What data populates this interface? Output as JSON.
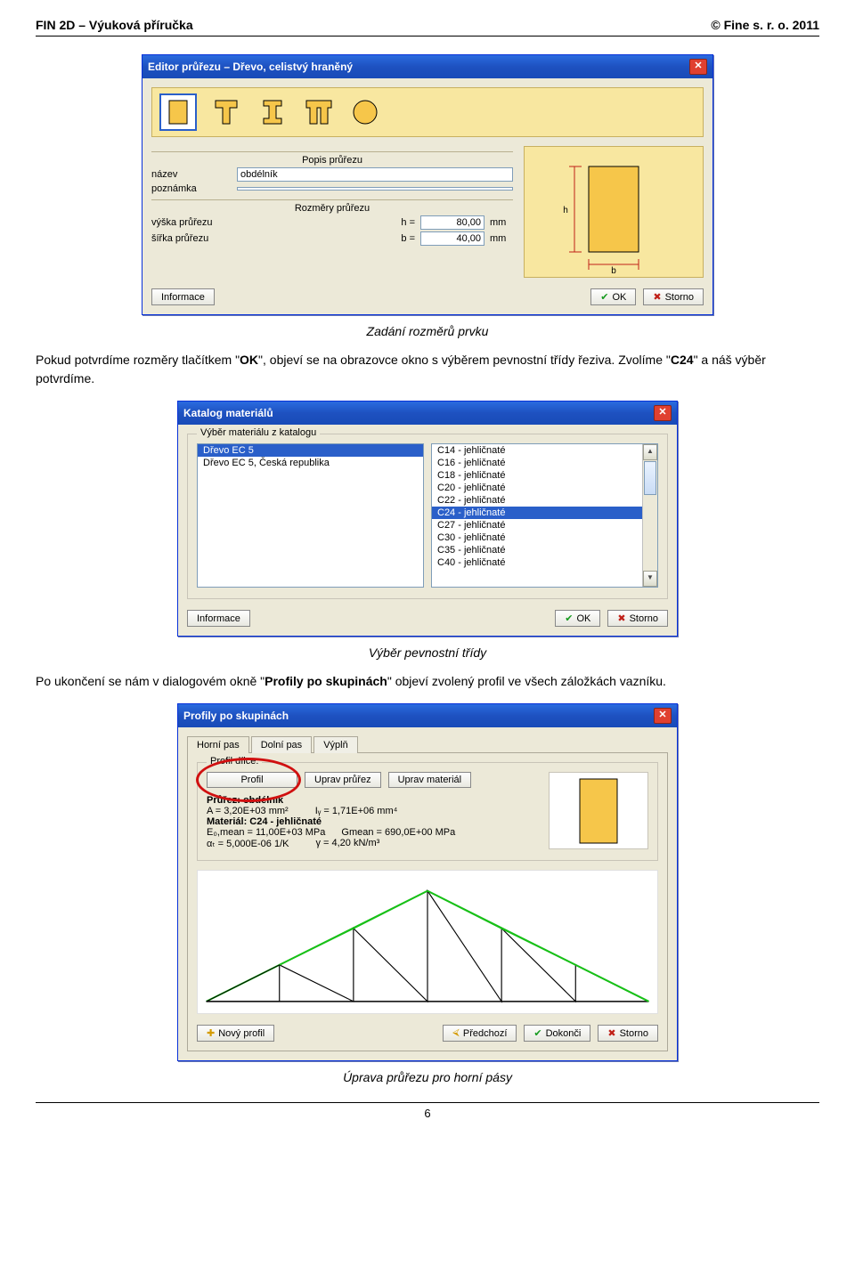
{
  "header": {
    "left": "FIN 2D – Výuková příručka",
    "right": "© Fine s. r. o. 2011"
  },
  "caption1": "Zadání rozměrů prvku",
  "para1_a": "Pokud potvrdíme rozměry tlačítkem \"",
  "para1_b": "OK",
  "para1_c": "\", objeví se na obrazovce okno s výběrem pevnostní třídy řeziva. Zvolíme \"",
  "para1_d": "C24",
  "para1_e": "\" a náš výběr potvrdíme.",
  "caption2": "Výběr pevnostní třídy",
  "para2_a": "Po ukončení se nám v dialogovém okně \"",
  "para2_b": "Profily po skupinách",
  "para2_c": "\" objeví zvolený profil ve všech záložkách vazníku.",
  "caption3": "Úprava průřezu pro horní pásy",
  "page_number": "6",
  "common": {
    "ok": "OK",
    "storno": "Storno",
    "informace": "Informace"
  },
  "editor": {
    "title": "Editor průřezu – Dřevo, celistvý hraněný",
    "section_popis": "Popis průřezu",
    "section_rozmery": "Rozměry průřezu",
    "lbl_nazev": "název",
    "lbl_poznamka": "poznámka",
    "val_nazev": "obdélník",
    "val_poznamka": "",
    "lbl_vyska": "výška průřezu",
    "lbl_sirka": "šířka průřezu",
    "sym_h": "h =",
    "sym_b": "b =",
    "val_h": "80,00",
    "val_b": "40,00",
    "unit": "mm",
    "dim_h": "h",
    "dim_b": "b"
  },
  "katalog": {
    "title": "Katalog materiálů",
    "group": "Výběr materiálu z katalogu",
    "left": [
      "Dřevo EC 5",
      "Dřevo EC 5, Česká republika"
    ],
    "right": [
      "C14 - jehličnaté",
      "C16 - jehličnaté",
      "C18 - jehličnaté",
      "C20 - jehličnaté",
      "C22 - jehličnaté",
      "C24 - jehličnaté",
      "C27 - jehličnaté",
      "C30 - jehličnaté",
      "C35 - jehličnaté",
      "C40 - jehličnaté"
    ],
    "left_selected_index": 0,
    "right_selected_index": 5
  },
  "profily": {
    "title": "Profily po skupinách",
    "tabs": [
      "Horní pas",
      "Dolní pas",
      "Výplň"
    ],
    "active_tab": 0,
    "group_label": "Profil dílce:",
    "btn_profil": "Profil",
    "btn_uprav_prurez": "Uprav průřez",
    "btn_uprav_material": "Uprav materiál",
    "line_prurez": "Průřez: obdélník",
    "line_A": "A = 3,20E+03 mm²",
    "line_Iy": "Iᵧ = 1,71E+06 mm⁴",
    "line_material": "Materiál: C24 - jehličnaté",
    "line_E": "E₀,mean = 11,00E+03 MPa",
    "line_G": "Gmean = 690,0E+00 MPa",
    "line_alpha": "αₜ = 5,000E-06 1/K",
    "line_gamma": "γ = 4,20 kN/m³",
    "btn_novy": "Nový profil",
    "btn_predchozi": "Předchozí",
    "btn_dokonci": "Dokonči"
  }
}
